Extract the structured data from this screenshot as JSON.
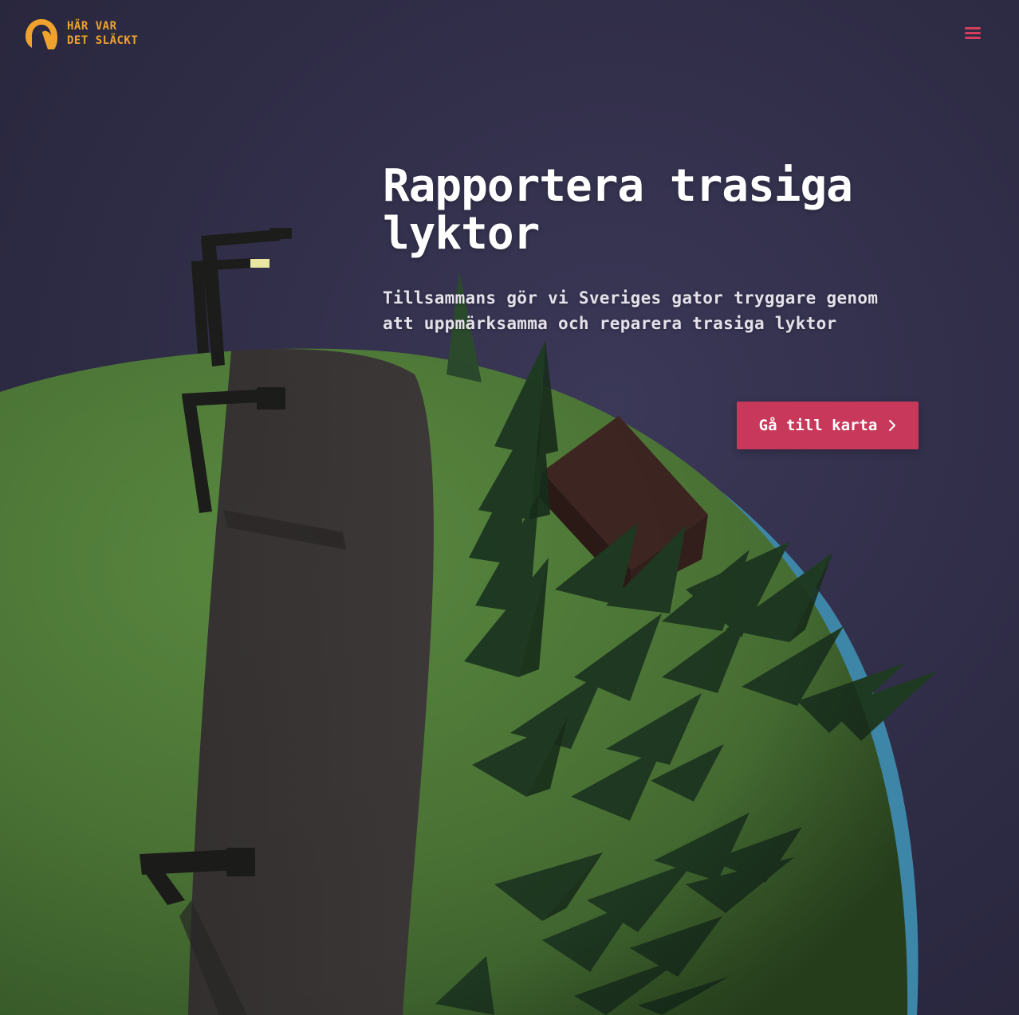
{
  "header": {
    "logo_text": "HÄR VAR\nDET SLÄCKT",
    "logo_icon": "streetlamp-logo-icon",
    "menu_icon": "hamburger-menu-icon"
  },
  "hero": {
    "title": "Rapportera trasiga lyktor",
    "subtitle": "Tillsammans gör vi Sveriges gator tryggare genom att uppmärksamma och reparera trasiga lyktor",
    "cta_label": "Gå till karta",
    "cta_icon": "chevron-right-icon"
  },
  "colors": {
    "background": "#2f2c46",
    "brand_yellow": "#f0a22e",
    "accent": "#c8385a",
    "grass": "#4f7a3a",
    "road": "#3a3636",
    "trees": "#1f3a22",
    "house": "#3b2420",
    "water": "#3e86a8"
  }
}
